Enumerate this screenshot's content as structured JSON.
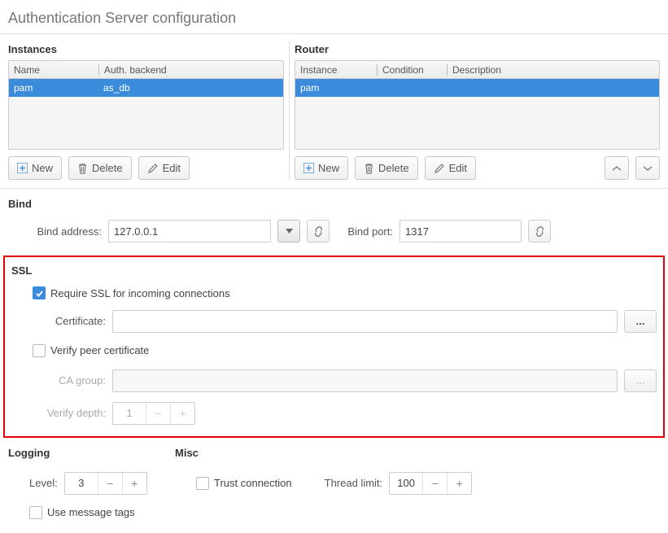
{
  "title": "Authentication Server configuration",
  "instances": {
    "title": "Instances",
    "headers": {
      "name": "Name",
      "backend": "Auth. backend"
    },
    "rows": [
      {
        "name": "pam",
        "backend": "as_db"
      }
    ],
    "buttons": {
      "new": "New",
      "delete": "Delete",
      "edit": "Edit"
    }
  },
  "router": {
    "title": "Router",
    "headers": {
      "instance": "Instance",
      "condition": "Condition",
      "description": "Description"
    },
    "rows": [
      {
        "instance": "pam",
        "condition": "",
        "description": ""
      }
    ],
    "buttons": {
      "new": "New",
      "delete": "Delete",
      "edit": "Edit"
    }
  },
  "bind": {
    "title": "Bind",
    "addr_label": "Bind address:",
    "addr_value": "127.0.0.1",
    "port_label": "Bind port:",
    "port_value": "1317"
  },
  "ssl": {
    "title": "SSL",
    "require_label": "Require SSL for incoming connections",
    "require_checked": true,
    "cert_label": "Certificate:",
    "cert_value": "",
    "verify_label": "Verify peer certificate",
    "verify_checked": false,
    "cagroup_label": "CA group:",
    "cagroup_value": "",
    "depth_label": "Verify depth:",
    "depth_value": "1",
    "browse": "..."
  },
  "logging": {
    "title": "Logging",
    "level_label": "Level:",
    "level_value": "3",
    "tags_label": "Use message tags",
    "tags_checked": false
  },
  "misc": {
    "title": "Misc",
    "trust_label": "Trust connection",
    "trust_checked": false,
    "thread_label": "Thread limit:",
    "thread_value": "100"
  }
}
